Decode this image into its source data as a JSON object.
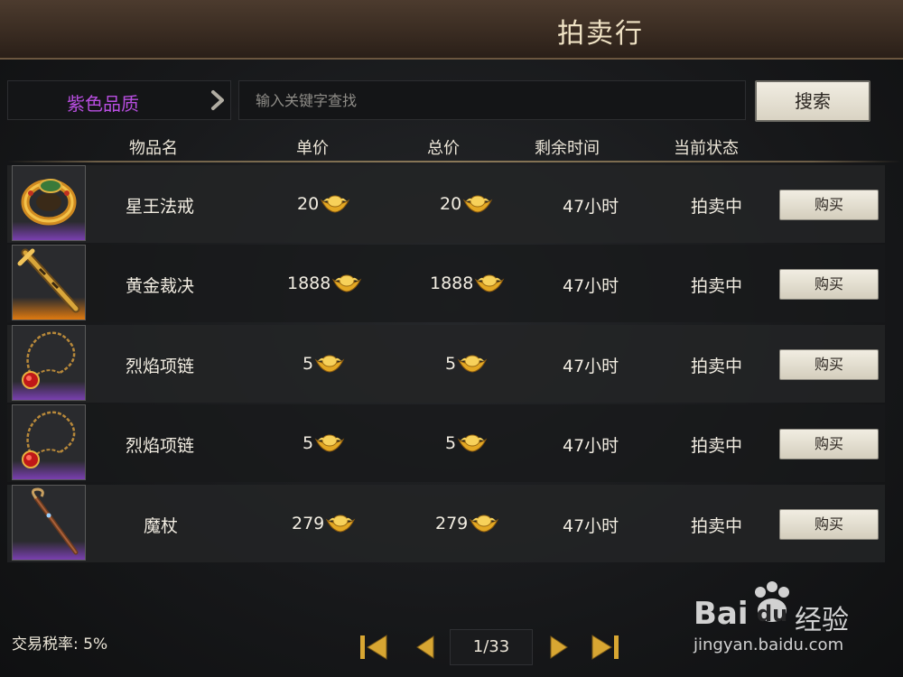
{
  "window": {
    "title": "拍卖行"
  },
  "filter": {
    "quality_label": "紫色品质",
    "search_placeholder": "输入关键字查找",
    "search_value": "",
    "search_button": "搜索"
  },
  "columns": {
    "name": "物品名",
    "unit_price": "单价",
    "total_price": "总价",
    "remaining": "剩余时间",
    "status": "当前状态"
  },
  "items": [
    {
      "name": "星王法戒",
      "unit_price": "20",
      "total_price": "20",
      "remaining": "47小时",
      "status": "拍卖中",
      "buy": "购买",
      "icon": "ring-icon",
      "rarity": "purple"
    },
    {
      "name": "黄金裁决",
      "unit_price": "1888",
      "total_price": "1888",
      "remaining": "47小时",
      "status": "拍卖中",
      "buy": "购买",
      "icon": "golden-sword-icon",
      "rarity": "orange"
    },
    {
      "name": "烈焰项链",
      "unit_price": "5",
      "total_price": "5",
      "remaining": "47小时",
      "status": "拍卖中",
      "buy": "购买",
      "icon": "necklace-icon",
      "rarity": "purple"
    },
    {
      "name": "烈焰项链",
      "unit_price": "5",
      "total_price": "5",
      "remaining": "47小时",
      "status": "拍卖中",
      "buy": "购买",
      "icon": "necklace-icon",
      "rarity": "purple"
    },
    {
      "name": "魔杖",
      "unit_price": "279",
      "total_price": "279",
      "remaining": "47小时",
      "status": "拍卖中",
      "buy": "购买",
      "icon": "staff-icon",
      "rarity": "purple"
    }
  ],
  "footer": {
    "tax": "交易税率: 5%",
    "page": "1/33"
  },
  "watermark": {
    "brand": "Bai",
    "brand2": "du",
    "cn": "经验",
    "url": "jingyan.baidu.com"
  },
  "colors": {
    "purple_quality": "#b84ee0",
    "rarity_purple": "#7a3fb0",
    "rarity_orange": "#e07a10",
    "ingot_gold": "#f0c030"
  }
}
